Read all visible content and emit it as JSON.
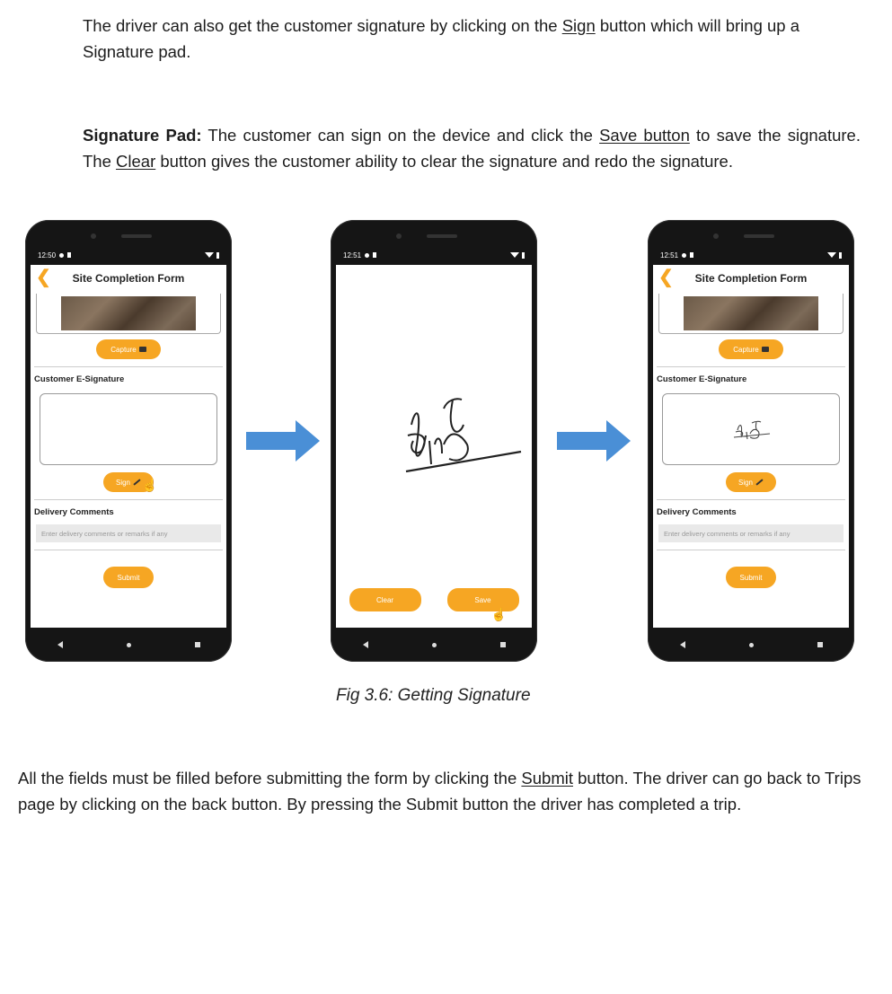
{
  "text": {
    "p1_a": "The driver can also get the customer signature by clicking on the ",
    "p1_link": "Sign",
    "p1_b": " button which will bring up a Signature pad.",
    "p2_bold": "Signature Pad:",
    "p2_a": " The customer can sign on the device and click the ",
    "p2_link1": "Save button",
    "p2_b": " to save the signature. The ",
    "p2_link2": "Clear",
    "p2_c": " button gives the customer ability to clear the signature and redo the signature.",
    "caption": "Fig 3.6: Getting Signature",
    "p3_a": "All the fields must be filled before submitting the form by clicking the ",
    "p3_link": "Submit",
    "p3_b": " button. The driver can go back to Trips page by clicking on the back button. By pressing the Submit button the driver has completed a trip."
  },
  "phone1": {
    "time": "12:50",
    "title": "Site Completion Form",
    "capture": "Capture",
    "esig_label": "Customer E-Signature",
    "sign": "Sign",
    "comments_label": "Delivery Comments",
    "comments_placeholder": "Enter delivery comments or remarks if any",
    "submit": "Submit"
  },
  "phone2": {
    "time": "12:51",
    "clear": "Clear",
    "save": "Save"
  },
  "phone3": {
    "time": "12:51",
    "title": "Site Completion Form",
    "capture": "Capture",
    "esig_label": "Customer E-Signature",
    "sign": "Sign",
    "comments_label": "Delivery Comments",
    "comments_placeholder": "Enter delivery comments or remarks if any",
    "submit": "Submit"
  },
  "colors": {
    "accent": "#f6a623",
    "arrow": "#4a8fd6"
  },
  "icons": [
    "back-chevron-icon",
    "camera-icon",
    "pen-icon",
    "hand-cursor-icon",
    "right-arrow-icon"
  ]
}
